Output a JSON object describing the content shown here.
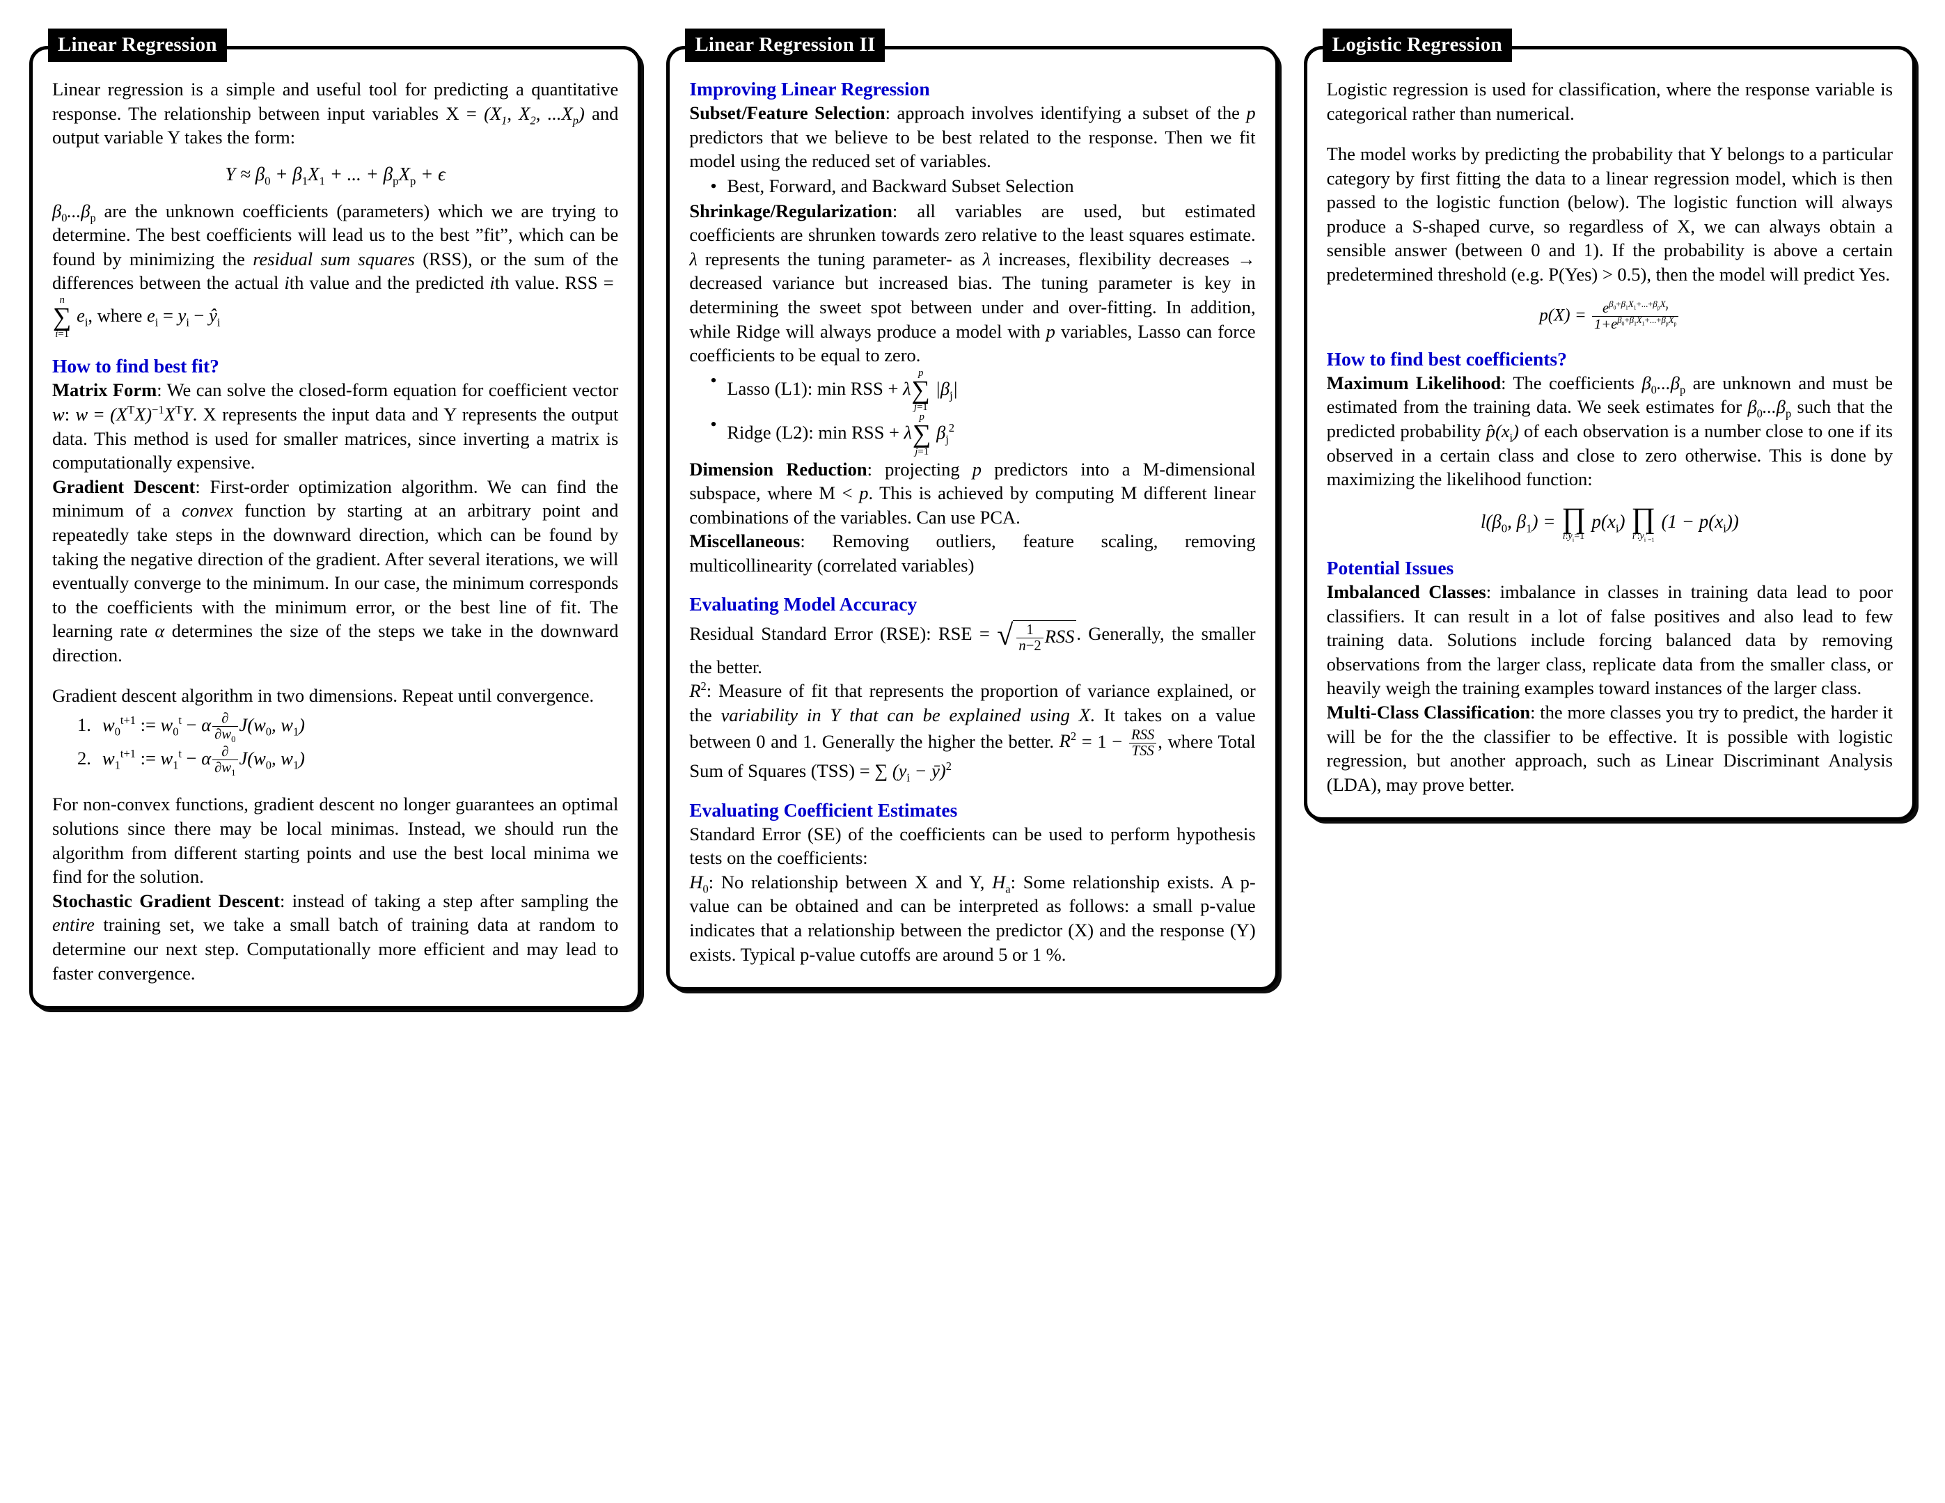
{
  "document": {
    "type": "machine-learning-cheat-sheet",
    "accent_blue": "#0000CC",
    "title_bar_bg": "#000000",
    "title_bar_fg": "#FFFFFF"
  },
  "panels": [
    {
      "title": "Linear Regression",
      "intro": "Linear regression is a simple and useful tool for predicting a quantitative response. The relationship between input variables X = (X₁, X₂, ...Xₚ) and output variable Y takes the form:",
      "equation_model": "Y ≈ β₀ + β₁X₁ + ... + βₚXₚ + ϵ",
      "para_coefficients": "β₀...βₚ are the unknown coefficients (parameters) which we are trying to determine. The best coefficients will lead us to the best \"fit\", which can be found by minimizing the residual sum squares (RSS), or the sum of the differences between the actual ith value and the predicted ith value. RSS = ∑ⁿᵢ₌₁ eᵢ, where eᵢ = yᵢ − ŷᵢ",
      "heading_best_fit": "How to find best fit?",
      "matrix_form_label": "Matrix Form",
      "matrix_form_text": ": We can solve the closed-form equation for coefficient vector w: w = (XᵀX)⁻¹XᵀY. X represents the input data and Y represents the output data. This method is used for smaller matrices, since inverting a matrix is computationally expensive.",
      "gradient_descent_label": "Gradient Descent",
      "gradient_descent_text": ": First-order optimization algorithm. We can find the minimum of a convex function by starting at an arbitrary point and repeatedly take steps in the downward direction, which can be found by taking the negative direction of the gradient. After several iterations, we will eventually converge to the minimum. In our case, the minimum corresponds to the coefficients with the minimum error, or the best line of fit. The learning rate α determines the size of the steps we take in the downward direction.",
      "gd_algo_intro": "Gradient descent algorithm in two dimensions. Repeat until convergence.",
      "gd_steps": [
        {
          "num": "1.",
          "eq": "w₀ᵗ⁺¹ := w₀ᵗ − α ∂/∂w₀ J(w₀, w₁)"
        },
        {
          "num": "2.",
          "eq": "w₁ᵗ⁺¹ := w₁ᵗ − α ∂/∂w₁ J(w₀, w₁)"
        }
      ],
      "nonconvex_text": "For non-convex functions, gradient descent no longer guarantees an optimal solutions since there may be local minimas. Instead, we should run the algorithm from different starting points and use the best local minima we find for the solution.",
      "sgd_label": "Stochastic Gradient Descent",
      "sgd_text": ": instead of taking a step after sampling the entire training set, we take a small batch of training data at random to determine our next step. Computationally more efficient and may lead to faster convergence."
    },
    {
      "title": "Linear Regression II",
      "heading_improving": "Improving Linear Regression",
      "subset_label": "Subset/Feature Selection",
      "subset_text": ": approach involves identifying a subset of the p predictors that we believe to be best related to the response. Then we fit model using the reduced set of variables.",
      "subset_bullet": "Best, Forward, and Backward Subset Selection",
      "shrinkage_label": "Shrinkage/Regularization",
      "shrinkage_text": ": all variables are used, but estimated coefficients are shrunken towards zero relative to the least squares estimate. λ represents the tuning parameter- as λ increases, flexibility decreases → decreased variance but increased bias. The tuning parameter is key in determining the sweet spot between under and over-fitting. In addition, while Ridge will always produce a model with p variables, Lasso can force coefficients to be equal to zero.",
      "lasso_bullet": "Lasso (L1): min RSS + λ ∑ᵖⱼ₌₁ |βⱼ|",
      "ridge_bullet": "Ridge (L2): min RSS + λ ∑ᵖⱼ₌₁ βⱼ²",
      "dimred_label": "Dimension Reduction",
      "dimred_text": ": projecting p predictors into a M-dimensional subspace, where M < p. This is achieved by computing M different linear combinations of the variables. Can use PCA.",
      "misc_label": "Miscellaneous",
      "misc_text": ": Removing outliers, feature scaling, removing multicollinearity (correlated variables)",
      "heading_eval_accuracy": "Evaluating Model Accuracy",
      "rse_text_pre": "Residual Standard Error (RSE): RSE = ",
      "rse_formula": "√( 1/(n−2) RSS )",
      "rse_text_post": ". Generally, the smaller the better.",
      "r2_label": "R²",
      "r2_text": ": Measure of fit that represents the proportion of variance explained, or the variability in Y that can be explained using X. It takes on a value between 0 and 1. Generally the higher the better. R² = 1 − RSS/TSS, where Total Sum of Squares (TSS) = ∑ (yᵢ − ȳ)²",
      "heading_eval_coeff": "Evaluating Coefficient Estimates",
      "se_text": "Standard Error (SE) of the coefficients can be used to perform hypothesis tests on the coefficients:",
      "hypothesis_text": "H₀: No relationship between X and Y, Hₐ: Some relationship exists. A p-value can be obtained and can be interpreted as follows: a small p-value indicates that a relationship between the predictor (X) and the response (Y) exists. Typical p-value cutoffs are around 5 or 1 %."
    },
    {
      "title": "Logistic Regression",
      "intro": "Logistic regression is used for classification, where the response variable is categorical rather than numerical.",
      "model_text": "The model works by predicting the probability that Y belongs to a particular category by first fitting the data to a linear regression model, which is then passed to the logistic function (below). The logistic function will always produce a S-shaped curve, so regardless of X, we can always obtain a sensible answer (between 0 and 1). If the probability is above a certain predetermined threshold (e.g. P(Yes) > 0.5), then the model will predict Yes.",
      "logistic_equation": "p(X) = e^(β₀+β₁X₁+...+βₚXₚ) / (1+e^(β₀+β₁X₁+...+βₚXₚ))",
      "heading_best_coeff": "How to find best coefficients?",
      "mle_label": "Maximum Likelihood",
      "mle_text": ": The coefficients β₀...βₚ are unknown and must be estimated from the training data. We seek estimates for β₀...βₚ such that the predicted probability p̂(xᵢ) of each observation is a number close to one if its observed in a certain class and close to zero otherwise. This is done by maximizing the likelihood function:",
      "likelihood_equation": "l(β₀, β₁) = ∏ᵢ:ᵧᵢ₌₁ p(xᵢ) ∏ᵢ′:ᵧᵢ′₌₁ (1 − p(xᵢ))",
      "heading_issues": "Potential Issues",
      "imbalanced_label": "Imbalanced Classes",
      "imbalanced_text": ": imbalance in classes in training data lead to poor classifiers. It can result in a lot of false positives and also lead to few training data. Solutions include forcing balanced data by removing observations from the larger class, replicate data from the smaller class, or heavily weigh the training examples toward instances of the larger class.",
      "multiclass_label": "Multi-Class Classification",
      "multiclass_text": ": the more classes you try to predict, the harder it will be for the the classifier to be effective. It is possible with logistic regression, but another approach, such as Linear Discriminant Analysis (LDA), may prove better."
    }
  ]
}
